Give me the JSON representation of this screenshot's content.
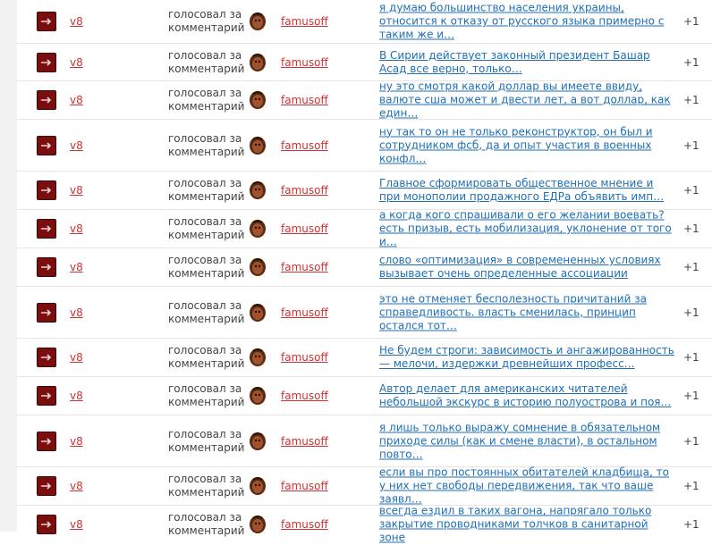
{
  "feed": {
    "rows": [
      {
        "user": "v8",
        "action": "голосовал за комментарий",
        "author": "famusoff",
        "comment": "я думаю большинство населения украины, относится к отказу от русского языка примерно с таким же и…",
        "score": "+1"
      },
      {
        "user": "v8",
        "action": "голосовал за комментарий",
        "author": "famusoff",
        "comment": "В Сирии действует законный президент Башар Асад все верно, только…",
        "score": "+1"
      },
      {
        "user": "v8",
        "action": "голосовал за комментарий",
        "author": "famusoff",
        "comment": "ну это смотря какой доллар вы имеете ввиду, валюте сша может и двести лет, а вот доллар, как един…",
        "score": "+1"
      },
      {
        "user": "v8",
        "action": "голосовал за комментарий",
        "author": "famusoff",
        "comment": "ну так то он не только реконструктор, он был и сотрудником фсб, да и опыт участия в военных конфл…",
        "score": "+1"
      },
      {
        "user": "v8",
        "action": "голосовал за комментарий",
        "author": "famusoff",
        "comment": "Главное сформировать общественное мнение и при монополии продажного ЕДРа объявить имп…",
        "score": "+1"
      },
      {
        "user": "v8",
        "action": "голосовал за комментарий",
        "author": "famusoff",
        "comment": "а когда кого спрашивали о его желании воевать? есть призыв, есть мобилизация, уклонение от того и…",
        "score": "+1"
      },
      {
        "user": "v8",
        "action": "голосовал за комментарий",
        "author": "famusoff",
        "comment": "слово «оптимизация» в современенных условиях вызывает очень определенные ассоциации",
        "score": "+1"
      },
      {
        "user": "v8",
        "action": "голосовал за комментарий",
        "author": "famusoff",
        "comment": "это не отменяет бесполезность причитаний за справедливость. власть сменилась, принцип остался тот…",
        "score": "+1"
      },
      {
        "user": "v8",
        "action": "голосовал за комментарий",
        "author": "famusoff",
        "comment": "Не будем строги: зависимость и ангажированность — мелочи, издержки древнейших професс…",
        "score": "+1"
      },
      {
        "user": "v8",
        "action": "голосовал за комментарий",
        "author": "famusoff",
        "comment": "Автор делает для американских читателей небольшой экскурс в историю полуострова и поя…",
        "score": "+1"
      },
      {
        "user": "v8",
        "action": "голосовал за комментарий",
        "author": "famusoff",
        "comment": "я лишь только выражу сомнение в обязательном приходе силы (как и смене власти), в остальном повто…",
        "score": "+1"
      },
      {
        "user": "v8",
        "action": "голосовал за комментарий",
        "author": "famusoff",
        "comment": "если вы про постоянных обитателей кладбища, то у них нет свободы передвижения, так что ваше заявл…",
        "score": "+1"
      },
      {
        "user": "v8",
        "action": "голосовал за комментарий",
        "author": "famusoff",
        "comment": "всегда ездил в таких вагона, напрягало только закрытие проводниками толчков в санитарной зоне",
        "score": "+1"
      }
    ]
  }
}
